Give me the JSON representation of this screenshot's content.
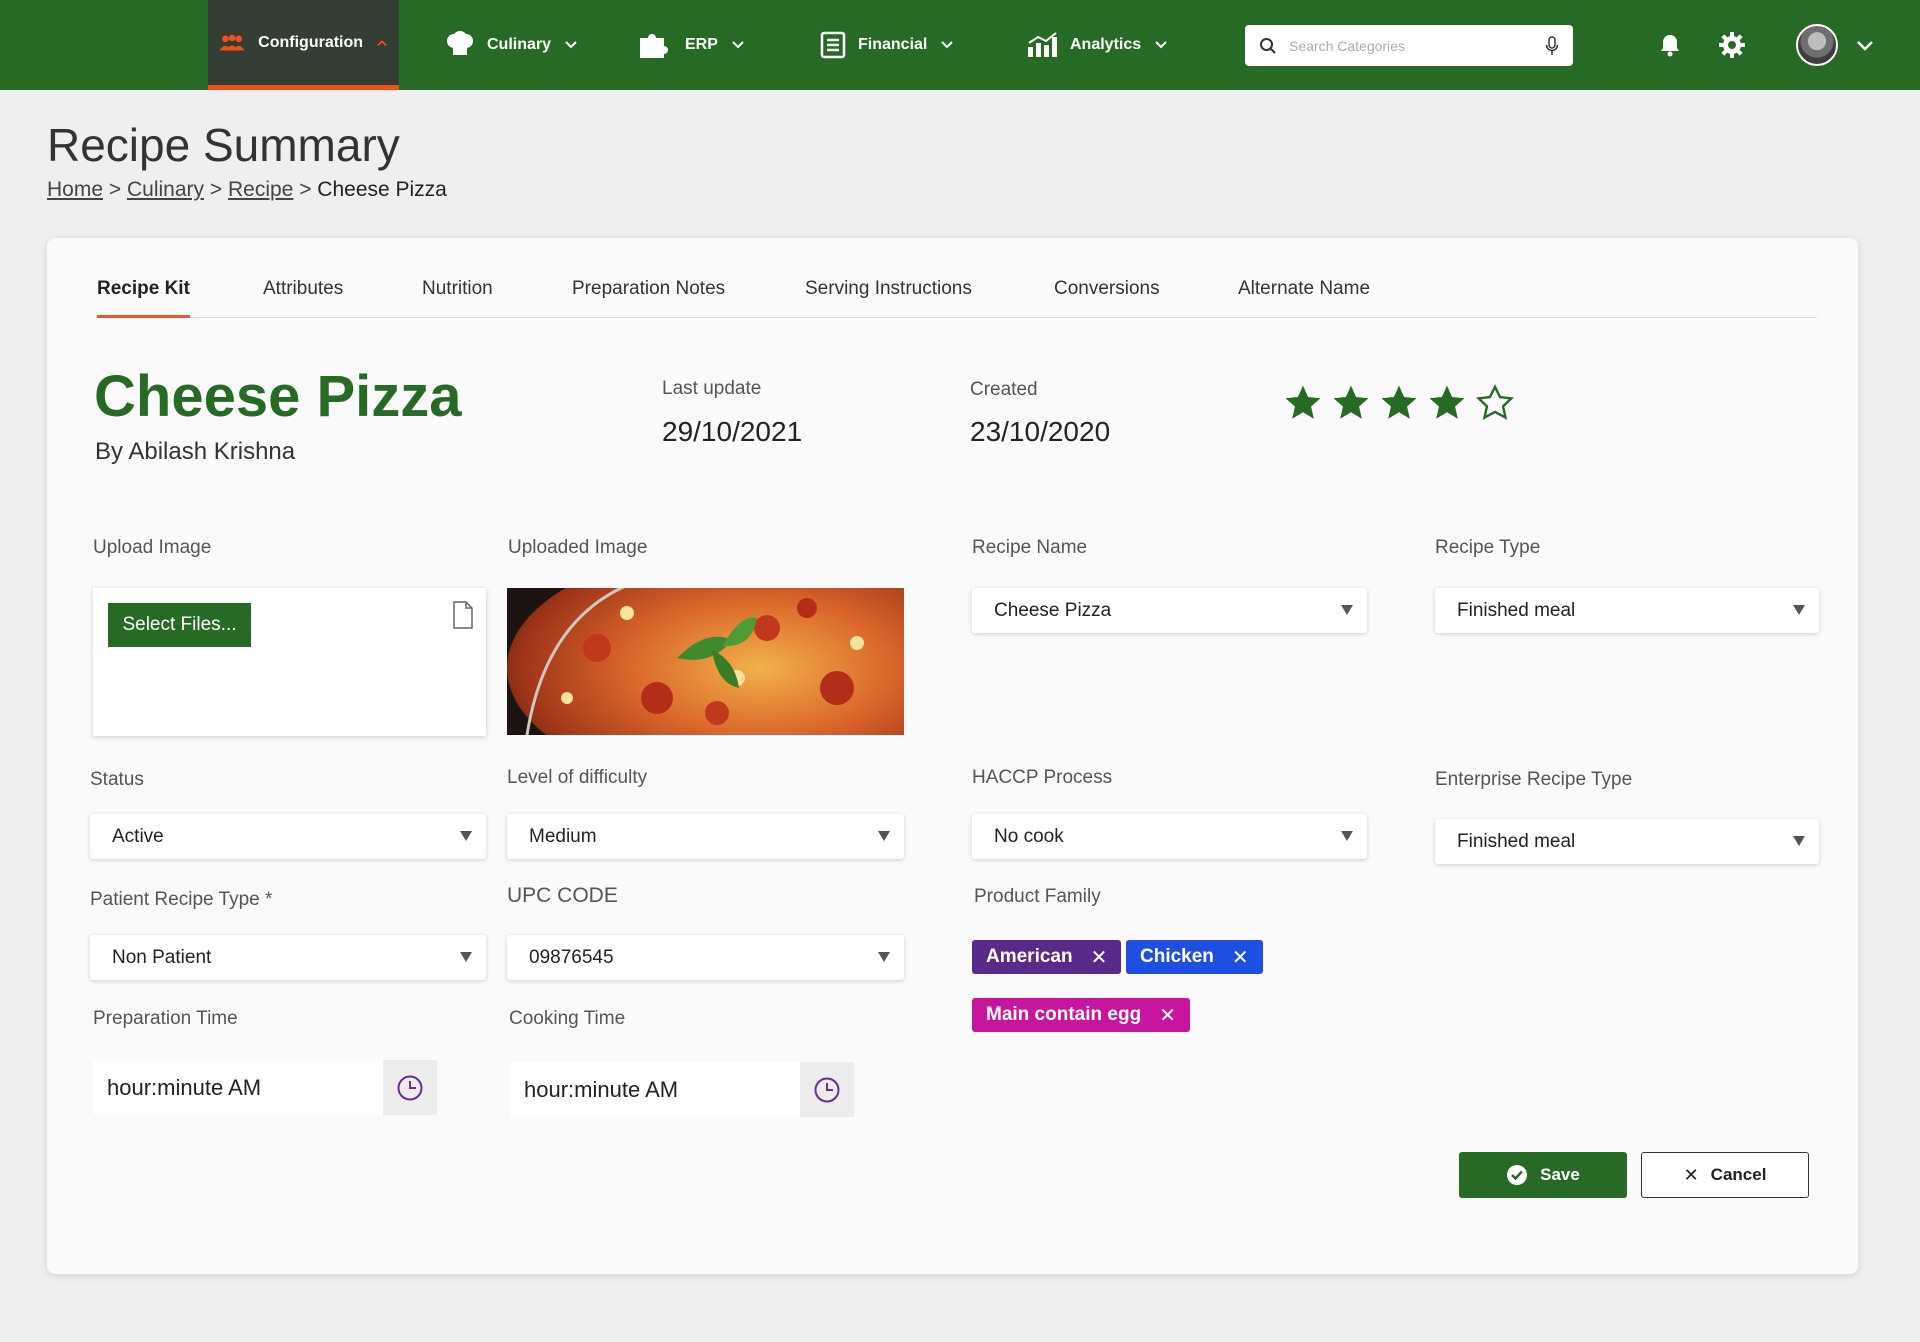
{
  "nav": {
    "items": [
      {
        "label": "Configuration"
      },
      {
        "label": "Culinary"
      },
      {
        "label": "ERP"
      },
      {
        "label": "Financial"
      },
      {
        "label": "Analytics"
      }
    ],
    "search_placeholder": "Search Categories",
    "accent_color": "#276a25",
    "active_indicator_color": "#f0501a"
  },
  "page": {
    "title": "Recipe Summary",
    "breadcrumb": [
      "Home",
      "Culinary",
      "Recipe",
      "Cheese Pizza"
    ],
    "separator": ">"
  },
  "tabs": [
    "Recipe Kit",
    "Attributes",
    "Nutrition",
    "Preparation Notes",
    "Serving Instructions",
    "Conversions",
    "Alternate Name"
  ],
  "recipe": {
    "title": "Cheese Pizza",
    "author": "By Abilash Krishna",
    "last_update_label": "Last update",
    "last_update": "29/10/2021",
    "created_label": "Created",
    "created": "23/10/2020",
    "rating": 4,
    "rating_max": 5
  },
  "form": {
    "upload_label": "Upload Image",
    "select_files": "Select Files...",
    "uploaded_label": "Uploaded Image",
    "recipe_name_label": "Recipe Name",
    "recipe_name": "Cheese Pizza",
    "recipe_type_label": "Recipe Type",
    "recipe_type": "Finished meal",
    "status_label": "Status",
    "status": "Active",
    "difficulty_label": "Level of difficulty",
    "difficulty": "Medium",
    "haccp_label": "HACCP Process",
    "haccp": "No cook",
    "enterprise_type_label": "Enterprise Recipe Type",
    "enterprise_type": "Finished meal",
    "patient_type_label": "Patient Recipe Type *",
    "patient_type": "Non Patient",
    "upc_label": "UPC CODE",
    "upc": "09876545",
    "product_family_label": "Product Family",
    "product_family": [
      {
        "label": "American",
        "color": "#5a2a8a"
      },
      {
        "label": "Chicken",
        "color": "#1f4fe0"
      },
      {
        "label": "Main contain egg",
        "color": "#c8159e"
      }
    ],
    "prep_time_label": "Preparation Time",
    "prep_time_placeholder": "hour:minute AM",
    "cook_time_label": "Cooking Time",
    "cook_time_placeholder": "hour:minute AM"
  },
  "actions": {
    "save": "Save",
    "cancel": "Cancel"
  }
}
